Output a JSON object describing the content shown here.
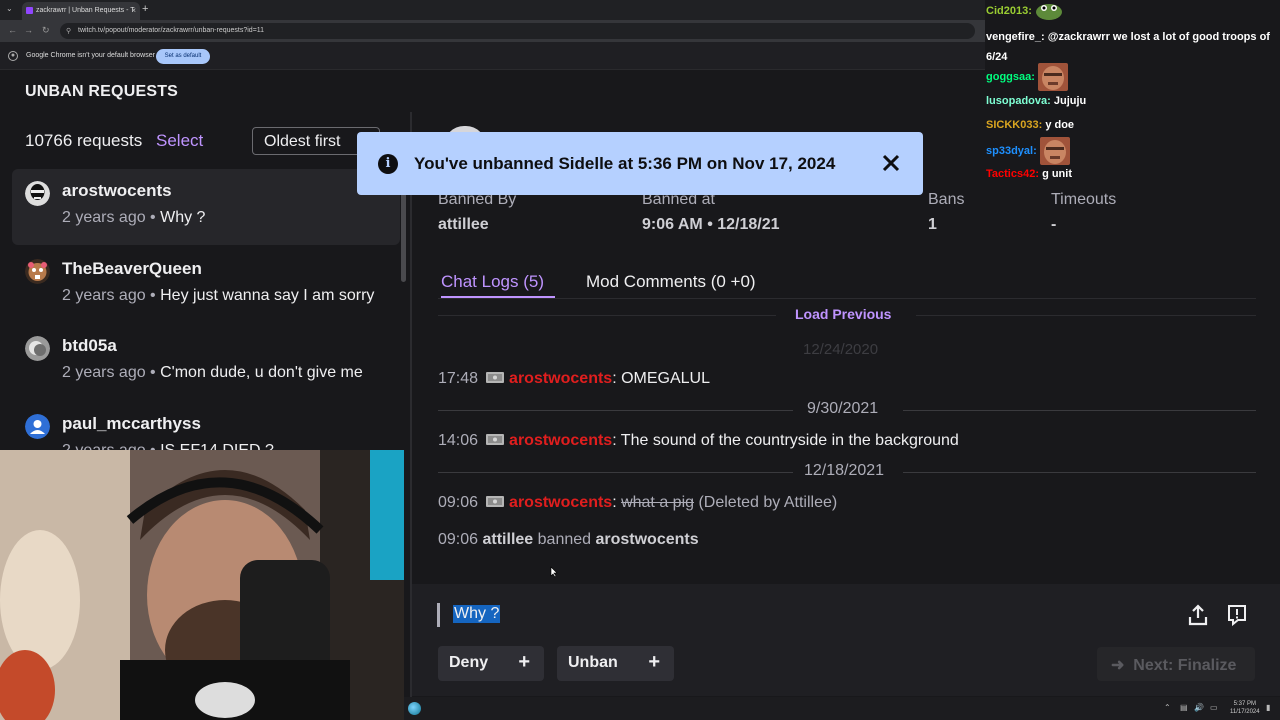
{
  "browser": {
    "tab_title": "zackrawrr | Unban Requests - T",
    "new_tab": "+",
    "url": "twitch.tv/popout/moderator/zackrawrr/unban-requests?id=11",
    "infobar_message": "Google Chrome isn't your default browser",
    "infobar_button": "Set as default"
  },
  "page": {
    "title": "UNBAN REQUESTS",
    "request_count": "10766 requests",
    "select_label": "Select",
    "sort_value": "Oldest first"
  },
  "requests": [
    {
      "username": "arostwocents",
      "time": "2 years ago",
      "sep": " • ",
      "message": "Why ?"
    },
    {
      "username": "TheBeaverQueen",
      "time": "2 years ago",
      "sep": " • ",
      "message": "Hey just wanna say I am sorry"
    },
    {
      "username": "btd05a",
      "time": "2 years ago",
      "sep": " • ",
      "message": "C'mon dude, u don't give me"
    },
    {
      "username": "paul_mccarthyss",
      "time": "2 years ago",
      "sep": " • ",
      "message": "IS EF14 DIED ?"
    }
  ],
  "toast": {
    "message": "You've unbanned Sidelle at 5:36 PM on Nov 17, 2024",
    "info_glyph": "i"
  },
  "detail": {
    "stats": [
      {
        "label": "Banned By",
        "value": "attillee"
      },
      {
        "label": "Banned at",
        "value": "9:06 AM • 12/18/21"
      },
      {
        "label": "Bans",
        "value": "1"
      },
      {
        "label": "Timeouts",
        "value": "-"
      }
    ],
    "tabs": {
      "chat_logs": "Chat Logs (5)",
      "mod_comments": "Mod Comments (0 +0)"
    },
    "load_previous": "Load Previous",
    "faded_date": "12/24/2020",
    "chat_log": [
      {
        "time": "17:48",
        "user": "arostwocents",
        "sep": ": ",
        "text": "OMEGALUL"
      },
      {
        "date": "9/30/2021"
      },
      {
        "time": "14:06",
        "user": "arostwocents",
        "sep": ": ",
        "text": "The sound of the countryside in the background"
      },
      {
        "date": "12/18/2021"
      },
      {
        "time": "09:06",
        "user": "arostwocents",
        "sep": ": ",
        "deleted_text": "what a pig",
        "note": "(Deleted by Attillee)"
      },
      {
        "time": "09:06",
        "actor": "attillee",
        "action": "banned",
        "target": "arostwocents"
      }
    ],
    "reply_text": "Why ?",
    "buttons": {
      "deny": "Deny",
      "unban": "Unban",
      "plus": "+",
      "next": "Next: Finalize"
    }
  },
  "chat_overlay": [
    {
      "user": "Cid2013:",
      "color": "#9acd32",
      "text": ""
    },
    {
      "user": "vengefire_:",
      "color": "#ffffff",
      "text": "@zackrawrr we lost a lot of good troops of 6/24"
    },
    {
      "user": "goggsaa:",
      "color": "#00ff7f",
      "text": ""
    },
    {
      "user": "lusopadova:",
      "color": "#7fffd4",
      "text": "Jujuju"
    },
    {
      "user": "SICKK033:",
      "color": "#daa520",
      "text": "y doe"
    },
    {
      "user": "sp33dyal:",
      "color": "#1e90ff",
      "text": ""
    },
    {
      "user": "Tactics42:",
      "color": "#ff0000",
      "text": "g unit"
    }
  ],
  "taskbar": {
    "time": "5:37 PM",
    "date": "11/17/2024"
  },
  "colors": {
    "accent": "#bf94ff",
    "toast_bg": "#b5d0ff",
    "chat_username": "#e01e1e",
    "background": "#18181b"
  }
}
